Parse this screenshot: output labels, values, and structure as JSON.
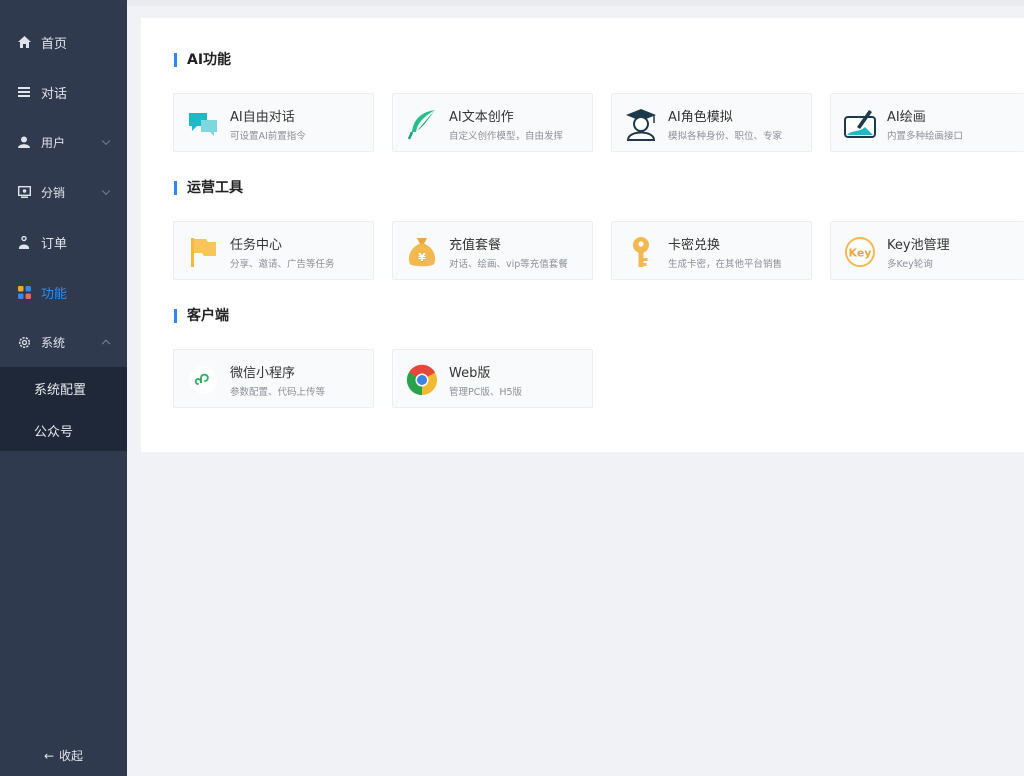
{
  "sidebar": {
    "items": [
      {
        "label": "首页",
        "icon": "home-icon"
      },
      {
        "label": "对话",
        "icon": "list-icon"
      },
      {
        "label": "用户",
        "icon": "user-icon"
      },
      {
        "label": "分销",
        "icon": "distribution-icon"
      },
      {
        "label": "订单",
        "icon": "order-icon"
      },
      {
        "label": "功能",
        "icon": "grid-icon"
      },
      {
        "label": "系统",
        "icon": "gear-icon"
      }
    ],
    "sub_items": [
      "系统配置",
      "公众号"
    ],
    "collapse_arrow": "←",
    "collapse_label": "收起",
    "active_color": "#2d8cf0"
  },
  "sections": [
    {
      "title": "AI功能",
      "cards": [
        {
          "title": "AI自由对话",
          "desc": "可设置AI前置指令",
          "icon": "chat-bubbles-icon"
        },
        {
          "title": "AI文本创作",
          "desc": "自定义创作模型，自由发挥",
          "icon": "feather-icon"
        },
        {
          "title": "AI角色模拟",
          "desc": "模拟各种身份、职位、专家",
          "icon": "graduate-icon"
        },
        {
          "title": "AI绘画",
          "desc": "内置多种绘画接口",
          "icon": "painting-icon"
        }
      ]
    },
    {
      "title": "运营工具",
      "cards": [
        {
          "title": "任务中心",
          "desc": "分享、邀请、广告等任务",
          "icon": "flag-icon"
        },
        {
          "title": "充值套餐",
          "desc": "对话、绘画、vip等充值套餐",
          "icon": "money-bag-icon",
          "glyph": "¥"
        },
        {
          "title": "卡密兑换",
          "desc": "生成卡密，在其他平台销售",
          "icon": "key-icon"
        },
        {
          "title": "Key池管理",
          "desc": "多Key轮询",
          "icon": "key-badge-icon",
          "glyph": "Key"
        }
      ]
    },
    {
      "title": "客户端",
      "cards": [
        {
          "title": "微信小程序",
          "desc": "参数配置、代码上传等",
          "icon": "miniprogram-icon"
        },
        {
          "title": "Web版",
          "desc": "管理PC版、H5版",
          "icon": "chrome-icon"
        }
      ]
    }
  ]
}
